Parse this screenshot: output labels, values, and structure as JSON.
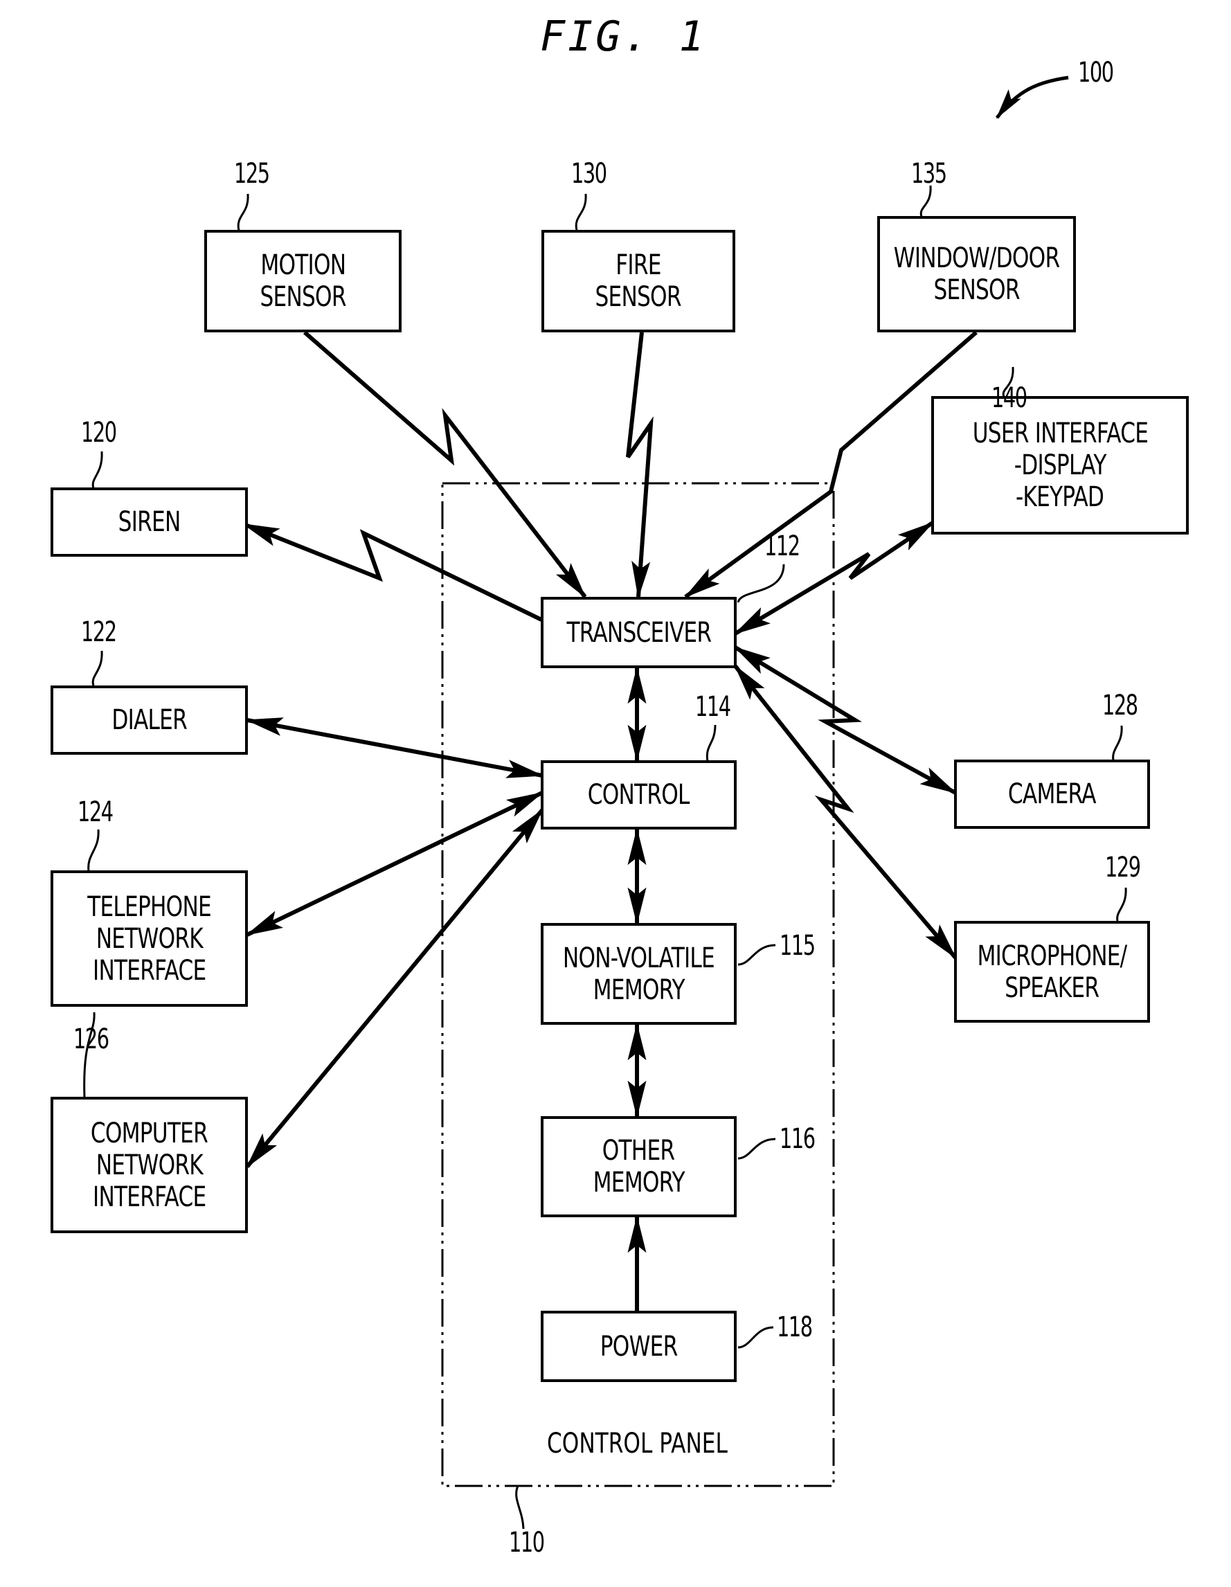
{
  "figure": {
    "title": "FIG. 1",
    "system_ref": "100"
  },
  "control_panel": {
    "label": "CONTROL PANEL",
    "ref": "110"
  },
  "blocks": {
    "transceiver": {
      "lines": [
        "TRANSCEIVER"
      ],
      "ref": "112"
    },
    "control": {
      "lines": [
        "CONTROL"
      ],
      "ref": "114"
    },
    "nonvolatile_memory": {
      "lines": [
        "NON-VOLATILE",
        "MEMORY"
      ],
      "ref": "115"
    },
    "other_memory": {
      "lines": [
        "OTHER",
        "MEMORY"
      ],
      "ref": "116"
    },
    "power": {
      "lines": [
        "POWER"
      ],
      "ref": "118"
    },
    "siren": {
      "lines": [
        "SIREN"
      ],
      "ref": "120"
    },
    "dialer": {
      "lines": [
        "DIALER"
      ],
      "ref": "122"
    },
    "telephone_network_interface": {
      "lines": [
        "TELEPHONE",
        "NETWORK",
        "INTERFACE"
      ],
      "ref": "124"
    },
    "motion_sensor": {
      "lines": [
        "MOTION",
        "SENSOR"
      ],
      "ref": "125"
    },
    "computer_network_interface": {
      "lines": [
        "COMPUTER",
        "NETWORK",
        "INTERFACE"
      ],
      "ref": "126"
    },
    "camera": {
      "lines": [
        "CAMERA"
      ],
      "ref": "128"
    },
    "microphone_speaker": {
      "lines": [
        "MICROPHONE/",
        "SPEAKER"
      ],
      "ref": "129"
    },
    "fire_sensor": {
      "lines": [
        "FIRE",
        "SENSOR"
      ],
      "ref": "130"
    },
    "window_door_sensor": {
      "lines": [
        "WINDOW/DOOR",
        "SENSOR"
      ],
      "ref": "135"
    },
    "user_interface": {
      "lines": [
        "USER INTERFACE",
        "-DISPLAY",
        "-KEYPAD"
      ],
      "ref": "140"
    }
  },
  "connections": [
    {
      "from": "motion_sensor",
      "to": "transceiver",
      "type": "wireless",
      "direction": "to"
    },
    {
      "from": "fire_sensor",
      "to": "transceiver",
      "type": "wireless",
      "direction": "to"
    },
    {
      "from": "window_door_sensor",
      "to": "transceiver",
      "type": "wireless",
      "direction": "to"
    },
    {
      "from": "transceiver",
      "to": "siren",
      "type": "wireless",
      "direction": "to"
    },
    {
      "from": "transceiver",
      "to": "user_interface",
      "type": "wireless",
      "direction": "both"
    },
    {
      "from": "transceiver",
      "to": "camera",
      "type": "wireless",
      "direction": "both"
    },
    {
      "from": "transceiver",
      "to": "microphone_speaker",
      "type": "wireless",
      "direction": "both"
    },
    {
      "from": "transceiver",
      "to": "control",
      "type": "wired",
      "direction": "both"
    },
    {
      "from": "control",
      "to": "dialer",
      "type": "wired",
      "direction": "both"
    },
    {
      "from": "control",
      "to": "telephone_network_interface",
      "type": "wired",
      "direction": "both"
    },
    {
      "from": "control",
      "to": "computer_network_interface",
      "type": "wired",
      "direction": "both"
    },
    {
      "from": "control",
      "to": "nonvolatile_memory",
      "type": "wired",
      "direction": "both"
    },
    {
      "from": "nonvolatile_memory",
      "to": "other_memory",
      "type": "wired",
      "direction": "both"
    },
    {
      "from": "power",
      "to": "other_memory",
      "type": "wired",
      "direction": "to"
    }
  ]
}
